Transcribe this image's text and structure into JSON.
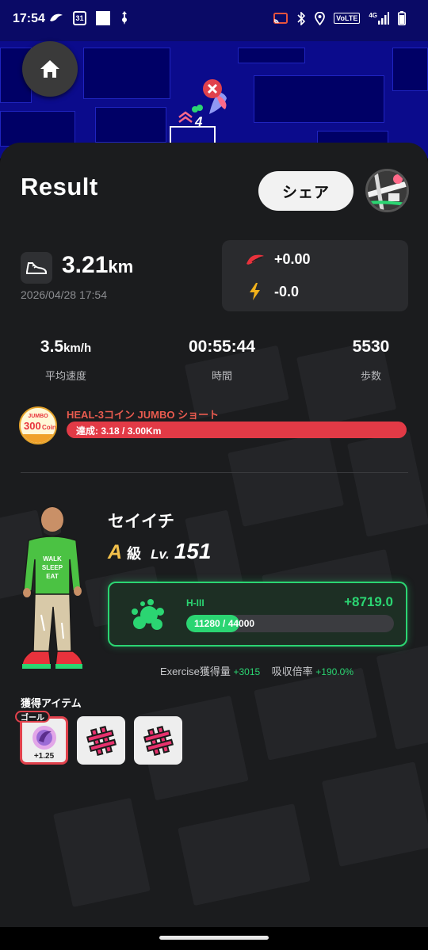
{
  "status_bar": {
    "time": "17:54",
    "calendar_day": "31",
    "volte_label": "VoLTE",
    "network_label": "4G",
    "icons": [
      "sneaker-icon",
      "calendar-icon",
      "square-icon",
      "usb-icon",
      "cast-icon",
      "bluetooth-icon",
      "location-icon",
      "signal-icon",
      "battery-icon"
    ]
  },
  "map": {
    "marker_level": "4",
    "icons": [
      "home-icon",
      "close-icon"
    ]
  },
  "header": {
    "title": "Result",
    "share_label": "シェア"
  },
  "summary": {
    "distance_value": "3.21",
    "distance_unit": "km",
    "datetime": "2026/04/28 17:54",
    "reward_1": "+0.00",
    "reward_2": "-0.0"
  },
  "stats": [
    {
      "value": "3.5",
      "unit": "km/h",
      "label": "平均速度"
    },
    {
      "value": "00:55:44",
      "unit": "",
      "label": "時間"
    },
    {
      "value": "5530",
      "unit": "",
      "label": "歩数"
    }
  ],
  "challenge": {
    "badge_text_1": "300",
    "badge_text_2": "Coin",
    "badge_text_3": "JUMBO",
    "title": "HEAL-3コイン JUMBO ショート",
    "progress_text": "達成: 3.18 / 3.00Km",
    "progress_fraction": 1.0
  },
  "character": {
    "shirt_text_1": "WALK",
    "shirt_text_2": "SLEEP",
    "shirt_text_3": "EAT",
    "name": "セイイチ",
    "grade": "A",
    "grade_suffix": "級",
    "level_label": "Lv.",
    "level": "151"
  },
  "exp": {
    "generator": "H-III",
    "gain": "+8719.0",
    "current": 11280,
    "max": 44000,
    "progress_text": "11280 / 44000",
    "info_label_1": "Exercise獲得量",
    "info_value_1": "+3015",
    "info_label_2": "吸収倍率",
    "info_value_2": "+190.0%"
  },
  "items": {
    "title": "獲得アイテム",
    "goal_tag": "ゴール",
    "list": [
      {
        "icon": "potion-icon",
        "value": "+1.25"
      },
      {
        "icon": "hashtag-icon",
        "value": ""
      },
      {
        "icon": "hashtag-icon",
        "value": ""
      }
    ]
  },
  "colors": {
    "panel": "#1b1c1e",
    "accent_green": "#2bd572",
    "accent_red": "#e23a46",
    "map_blue": "#0b0b8c"
  }
}
